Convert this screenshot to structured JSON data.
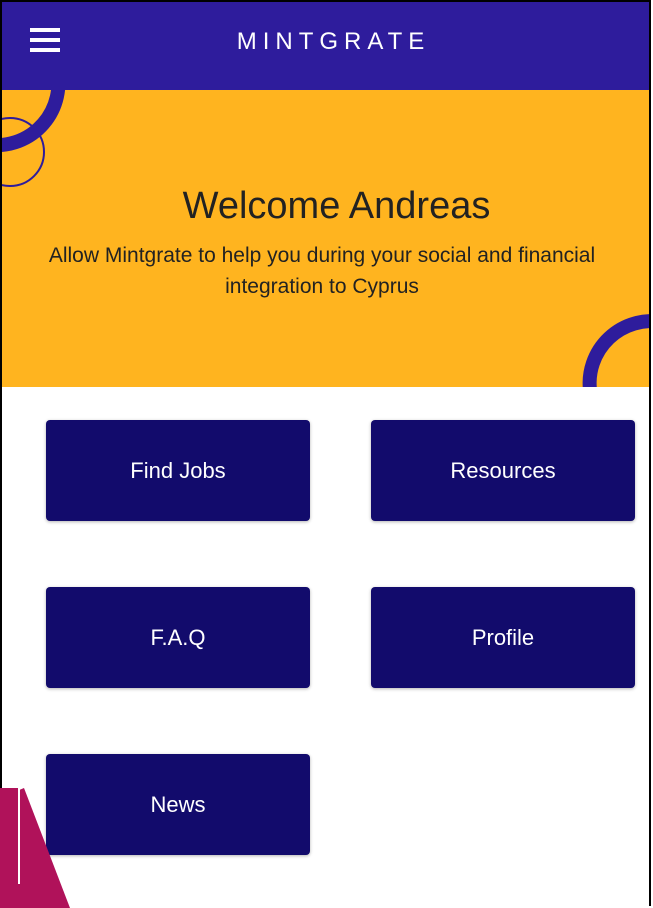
{
  "app_bar": {
    "title": "MINTGRATE",
    "menu_icon": "hamburger-menu-icon"
  },
  "hero": {
    "title": "Welcome Andreas",
    "subtitle": "Allow Mintgrate to help you during your social and financial integration to Cyprus"
  },
  "menu": {
    "items": [
      {
        "label": "Find Jobs"
      },
      {
        "label": "Resources"
      },
      {
        "label": "F.A.Q"
      },
      {
        "label": "Profile"
      },
      {
        "label": "News"
      }
    ]
  },
  "colors": {
    "app_bar": "#2e1c9c",
    "hero_background": "#ffb41f",
    "tile": "#120b6c",
    "decoration_accent": "#b0125a"
  }
}
